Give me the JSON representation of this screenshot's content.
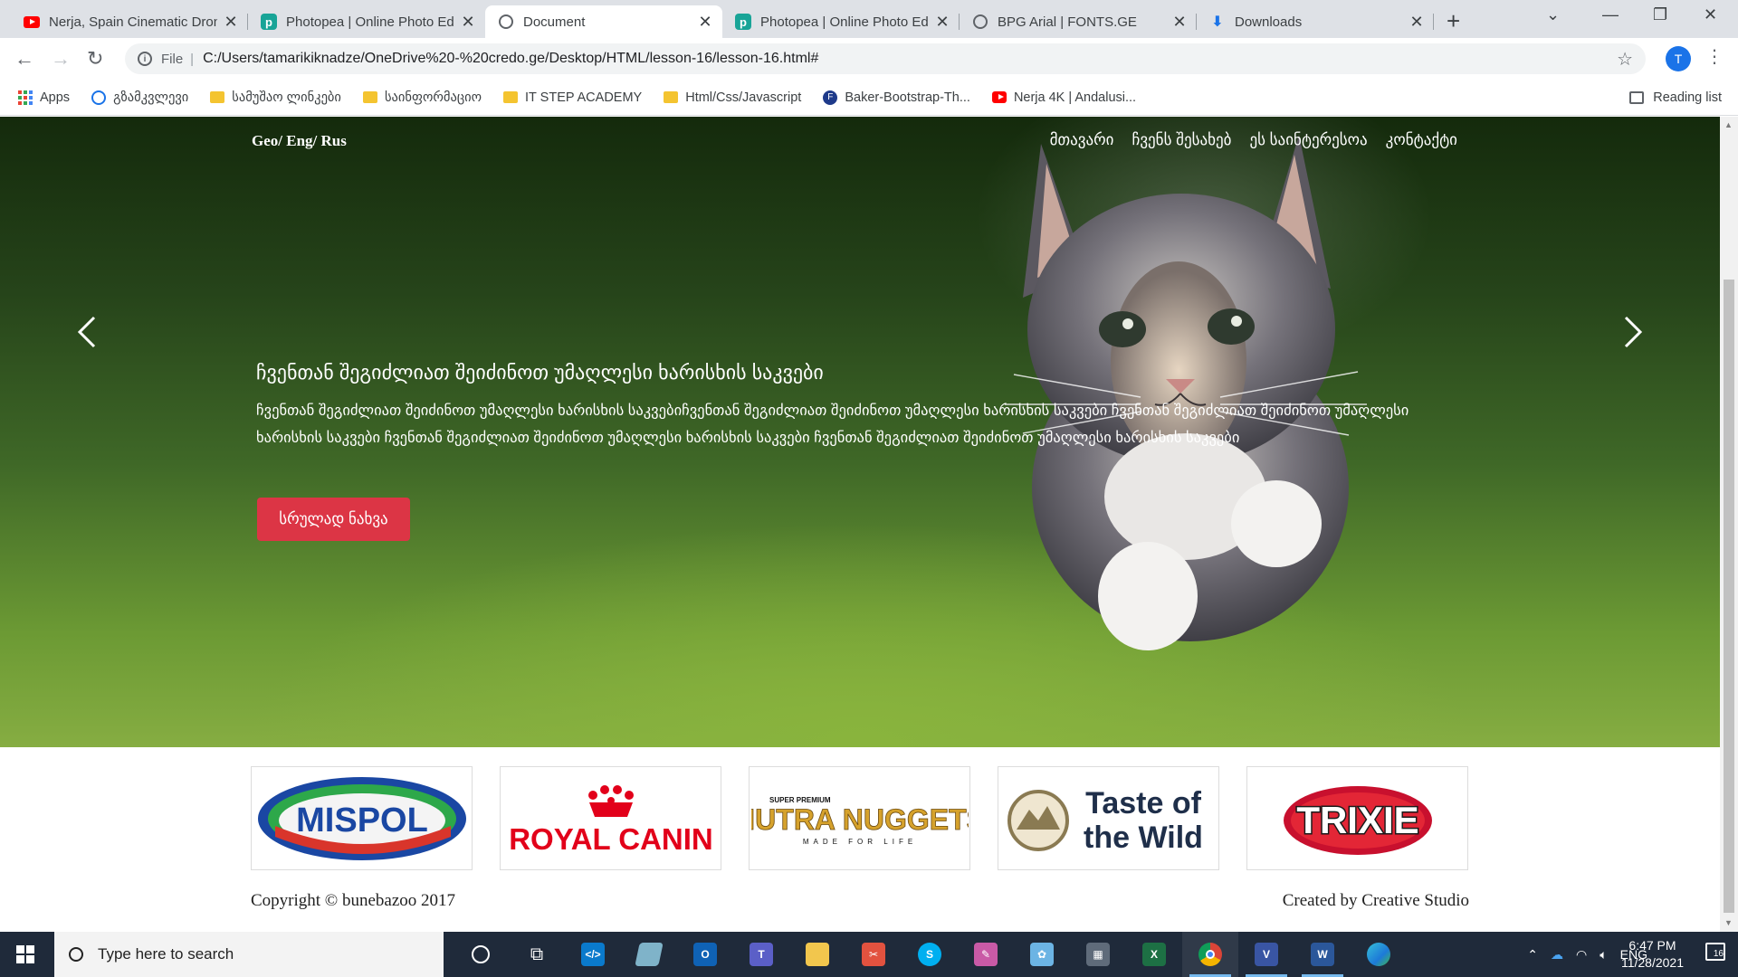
{
  "browser": {
    "tabs": [
      {
        "title": "Nerja, Spain Cinematic Drone",
        "icon": "youtube-icon",
        "active": false
      },
      {
        "title": "Photopea | Online Photo Editor",
        "icon": "photopea-icon",
        "active": false
      },
      {
        "title": "Document",
        "icon": "globe-icon",
        "active": true
      },
      {
        "title": "Photopea | Online Photo Editor",
        "icon": "photopea-icon",
        "active": false
      },
      {
        "title": "BPG Arial | FONTS.GE",
        "icon": "globe-icon",
        "active": false
      },
      {
        "title": "Downloads",
        "icon": "download-icon",
        "active": false
      }
    ],
    "address": {
      "scheme": "File",
      "url": "C:/Users/tamarikiknadze/OneDrive%20-%20credo.ge/Desktop/HTML/lesson-16/lesson-16.html#"
    },
    "profile_initial": "T",
    "bookmarks": [
      {
        "label": "Apps",
        "icon": "apps-grid-icon"
      },
      {
        "label": "გზამკვლევი",
        "icon": "globe-icon"
      },
      {
        "label": "სამუშაო ლინკები",
        "icon": "folder-icon"
      },
      {
        "label": "საინფორმაციო",
        "icon": "folder-icon"
      },
      {
        "label": "IT STEP ACADEMY",
        "icon": "folder-icon"
      },
      {
        "label": "Html/Css/Javascript",
        "icon": "folder-icon"
      },
      {
        "label": "Baker-Bootstrap-Th...",
        "icon": "site-f-icon"
      },
      {
        "label": "Nerja 4K | Andalusi...",
        "icon": "youtube-icon"
      }
    ],
    "reading_list": "Reading list"
  },
  "page": {
    "lang_switch": "Geo/ Eng/ Rus",
    "nav": [
      "მთავარი",
      "ჩვენს შესახებ",
      "ეს საინტერესოა",
      "კონტაქტი"
    ],
    "hero": {
      "heading": "ჩვენთან შეგიძლიათ შეიძინოთ უმაღლესი ხარისხის საკვები",
      "body": "ჩვენთან შეგიძლიათ შეიძინოთ უმაღლესი ხარისხის საკვებიჩვენთან შეგიძლიათ შეიძინოთ უმაღლესი ხარისხის საკვები ჩვენთან შეგიძლიათ შეიძინოთ უმაღლესი ხარისხის საკვები ჩვენთან შეგიძლიათ შეიძინოთ უმაღლესი ხარისხის საკვები ჩვენთან შეგიძლიათ შეიძინოთ უმაღლესი ხარისხის საკვები",
      "button": "სრულად ნახვა"
    },
    "brands": [
      {
        "name": "MISPOL"
      },
      {
        "name": "ROYAL CANIN"
      },
      {
        "name": "NUTRA NUGGETS",
        "tagline_top": "SUPER PREMIUM",
        "tagline_bottom": "MADE FOR LIFE"
      },
      {
        "name": "Taste of the Wild",
        "line1": "Taste of",
        "line2": "the Wild"
      },
      {
        "name": "TRIXIE"
      }
    ],
    "footer": {
      "copyright": "Copyright © bunebazoo 2017",
      "credit": "Created by Creative Studio"
    }
  },
  "taskbar": {
    "search_placeholder": "Type here to search",
    "language": "ENG",
    "time": "6:47 PM",
    "date": "11/28/2021",
    "notifications": "16"
  }
}
